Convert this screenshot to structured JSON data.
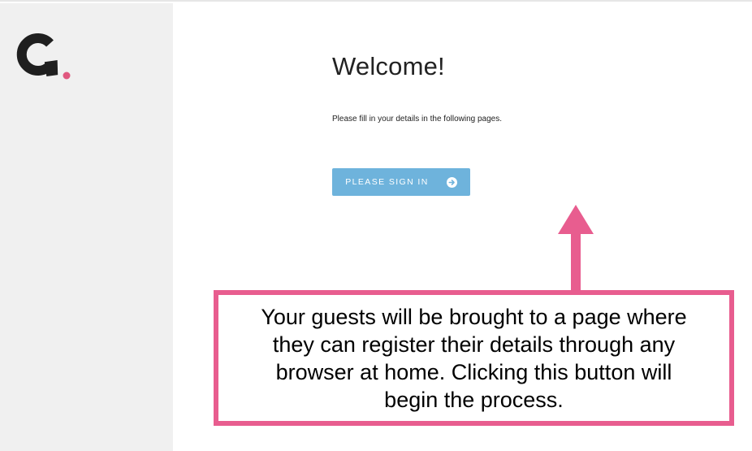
{
  "brand": {
    "logo_icon": "brand-g-logo-icon",
    "dark_color": "#1f1f1f",
    "accent_color": "#e0587f"
  },
  "main": {
    "title": "Welcome!",
    "instructions": "Please fill in your details in the following pages.",
    "signin_button": {
      "label": "PLEASE SIGN IN",
      "icon": "arrow-right-circle-icon",
      "color": "#6eb3dc"
    }
  },
  "annotation": {
    "arrow_icon": "up-arrow-icon",
    "color": "#e85d8f",
    "text": "Your guests will be brought to a page where they can register their details through any browser at home. Clicking this button will begin the process."
  }
}
